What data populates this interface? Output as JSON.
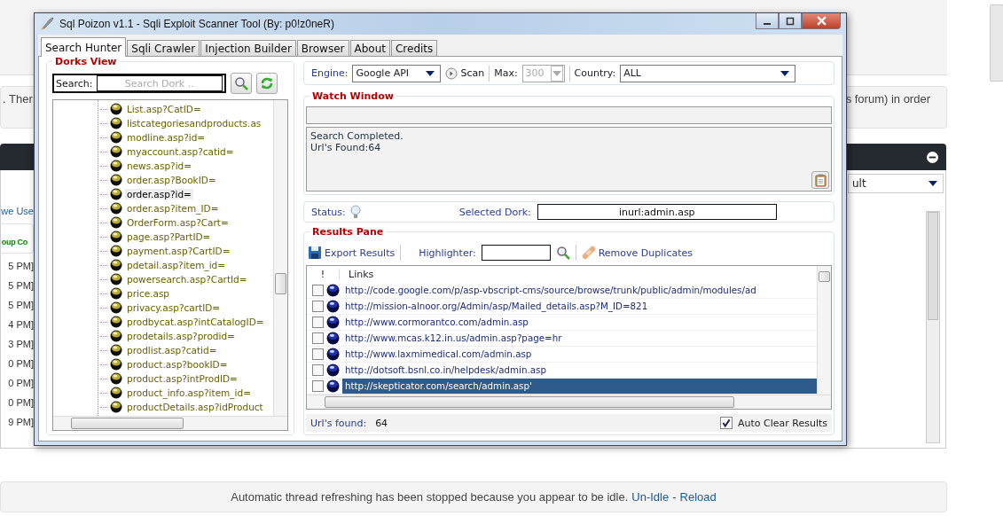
{
  "page": {
    "notice_left": ". Ther",
    "notice_right": "s forum) in order",
    "panel_select": "ult",
    "side_rows": [
      {
        "text": "we Use",
        "kind": "link"
      },
      {
        "text": "oup Co",
        "kind": "group"
      },
      {
        "text": "5 PM]",
        "kind": "time"
      },
      {
        "text": "5 PM]",
        "kind": "time"
      },
      {
        "text": "5 PM]",
        "kind": "time"
      },
      {
        "text": "4 PM]",
        "kind": "time"
      },
      {
        "text": "3 PM]",
        "kind": "time"
      },
      {
        "text": "0 PM]",
        "kind": "time"
      },
      {
        "text": "0 PM]",
        "kind": "time"
      },
      {
        "text": "0 PM]",
        "kind": "time"
      },
      {
        "text": "9 PM]",
        "kind": "time"
      }
    ],
    "idle_text": "Automatic thread refreshing has been stopped because you appear to be idle.",
    "idle_links": [
      "Un-Idle",
      "Reload"
    ],
    "idle_sep": "-"
  },
  "window": {
    "title": "Sql Poizon v1.1 - Sqli Exploit Scanner Tool (By: p0!z0neR)"
  },
  "tabs": [
    {
      "label": "Search Hunter",
      "selected": true
    },
    {
      "label": "Sqli Crawler",
      "selected": false
    },
    {
      "label": "Injection Builder",
      "selected": false
    },
    {
      "label": "Browser",
      "selected": false
    },
    {
      "label": "About",
      "selected": false
    },
    {
      "label": "Credits",
      "selected": false
    }
  ],
  "dorks": {
    "title": "Dorks View",
    "search_label": "Search:",
    "placeholder": "Search Dork ..",
    "items": [
      {
        "label": "List.asp?CatID=",
        "selected": false
      },
      {
        "label": "listcategoriesandproducts.as",
        "selected": false
      },
      {
        "label": "modline.asp?id=",
        "selected": false
      },
      {
        "label": "myaccount.asp?catid=",
        "selected": false
      },
      {
        "label": "news.asp?id=",
        "selected": false
      },
      {
        "label": "order.asp?BookID=",
        "selected": false
      },
      {
        "label": "order.asp?id=",
        "selected": true
      },
      {
        "label": "order.asp?item_ID=",
        "selected": false
      },
      {
        "label": "OrderForm.asp?Cart=",
        "selected": false
      },
      {
        "label": "page.asp?PartID=",
        "selected": false
      },
      {
        "label": "payment.asp?CartID=",
        "selected": false
      },
      {
        "label": "pdetail.asp?item_id=",
        "selected": false
      },
      {
        "label": "powersearch.asp?CartId=",
        "selected": false
      },
      {
        "label": "price.asp",
        "selected": false
      },
      {
        "label": "privacy.asp?cartID=",
        "selected": false
      },
      {
        "label": "prodbycat.asp?intCatalogID=",
        "selected": false
      },
      {
        "label": "prodetails.asp?prodid=",
        "selected": false
      },
      {
        "label": "prodlist.asp?catid=",
        "selected": false
      },
      {
        "label": "product.asp?bookID=",
        "selected": false
      },
      {
        "label": "product.asp?intProdID=",
        "selected": false
      },
      {
        "label": "product_info.asp?item_id=",
        "selected": false
      },
      {
        "label": "productDetails.asp?idProduct",
        "selected": false
      }
    ]
  },
  "engine_bar": {
    "engine_label": "Engine:",
    "engine": "Google API",
    "scan": "Scan",
    "max_label": "Max:",
    "max": "300",
    "max_disabled": true,
    "country_label": "Country:",
    "country": "ALL"
  },
  "watch": {
    "title": "Watch Window",
    "lines": [
      "Search Completed.",
      "Url's Found:64"
    ]
  },
  "status": {
    "label": "Status:",
    "dork_label": "Selected Dork:",
    "dork": "inurl:admin.asp"
  },
  "results": {
    "title": "Results Pane",
    "export": "Export Results",
    "highlighter_label": "Highlighter:",
    "remove": "Remove Duplicates",
    "columns": [
      "!",
      "Links"
    ],
    "rows": [
      {
        "link": "http://code.google.com/p/asp-vbscript-cms/source/browse/trunk/public/admin/modules/ad",
        "checked": false,
        "selected": false
      },
      {
        "link": "http://mission-alnoor.org/Admin/asp/Mailed_details.asp?M_ID=821",
        "checked": false,
        "selected": false
      },
      {
        "link": "http://www.cormorantco.com/admin.asp",
        "checked": false,
        "selected": false
      },
      {
        "link": "http://www.mcas.k12.in.us/admin.asp?page=hr",
        "checked": false,
        "selected": false
      },
      {
        "link": "http://www.laxmimedical.com/admin.asp",
        "checked": false,
        "selected": false
      },
      {
        "link": "http://dotsoft.bsnl.co.in/helpdesk/admin.asp",
        "checked": false,
        "selected": false
      },
      {
        "link": "http://skepticator.com/search/admin.asp'",
        "checked": false,
        "selected": true
      }
    ],
    "found_label": "Url's found:",
    "found": "64",
    "auto_clear": "Auto Clear Results",
    "auto_clear_checked": true
  }
}
